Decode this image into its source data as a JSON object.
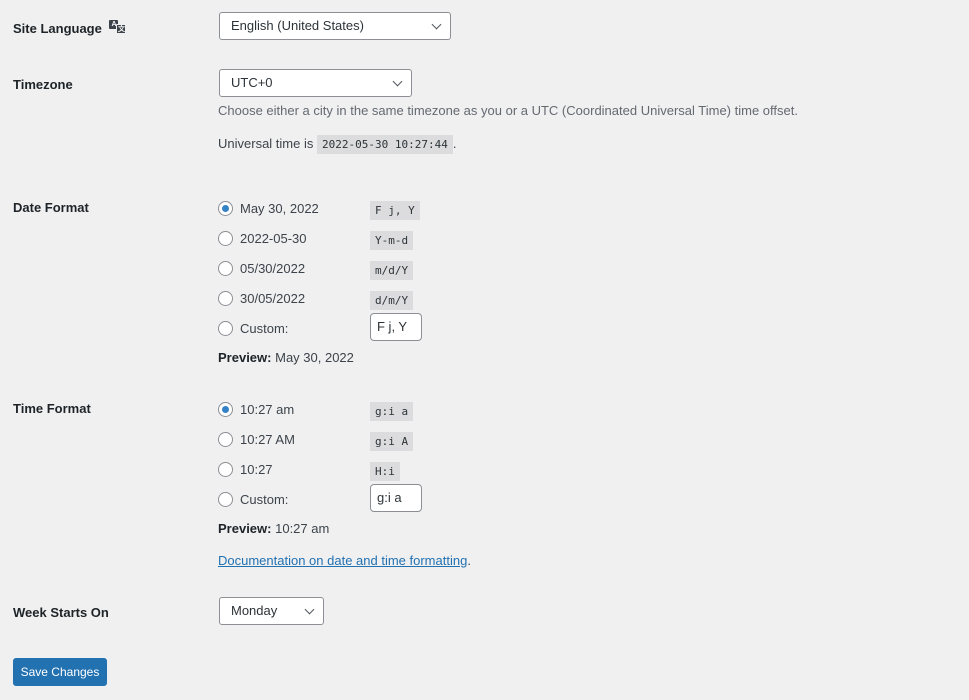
{
  "site_language": {
    "label": "Site Language",
    "icon": "translate-icon",
    "value": "English (United States)"
  },
  "timezone": {
    "label": "Timezone",
    "value": "UTC+0",
    "description": "Choose either a city in the same timezone as you or a UTC (Coordinated Universal Time) time offset.",
    "universal_prefix": "Universal time is",
    "universal_time": "2022-05-30 10:27:44",
    "universal_suffix": "."
  },
  "date_format": {
    "label": "Date Format",
    "options": [
      {
        "label": "May 30, 2022",
        "format": "F j, Y",
        "checked": true
      },
      {
        "label": "2022-05-30",
        "format": "Y-m-d",
        "checked": false
      },
      {
        "label": "05/30/2022",
        "format": "m/d/Y",
        "checked": false
      },
      {
        "label": "30/05/2022",
        "format": "d/m/Y",
        "checked": false
      }
    ],
    "custom_label": "Custom:",
    "custom_value": "F j, Y",
    "preview_label": "Preview:",
    "preview_value": "May 30, 2022"
  },
  "time_format": {
    "label": "Time Format",
    "options": [
      {
        "label": "10:27 am",
        "format": "g:i a",
        "checked": true
      },
      {
        "label": "10:27 AM",
        "format": "g:i A",
        "checked": false
      },
      {
        "label": "10:27",
        "format": "H:i",
        "checked": false
      }
    ],
    "custom_label": "Custom:",
    "custom_value": "g:i a",
    "preview_label": "Preview:",
    "preview_value": "10:27 am",
    "doc_link": "Documentation on date and time formatting",
    "doc_suffix": "."
  },
  "week_starts": {
    "label": "Week Starts On",
    "value": "Monday"
  },
  "save_label": "Save Changes",
  "colors": {
    "accent": "#2271b1",
    "radio_checked": "#3582c4",
    "background": "#f0f0f1"
  }
}
